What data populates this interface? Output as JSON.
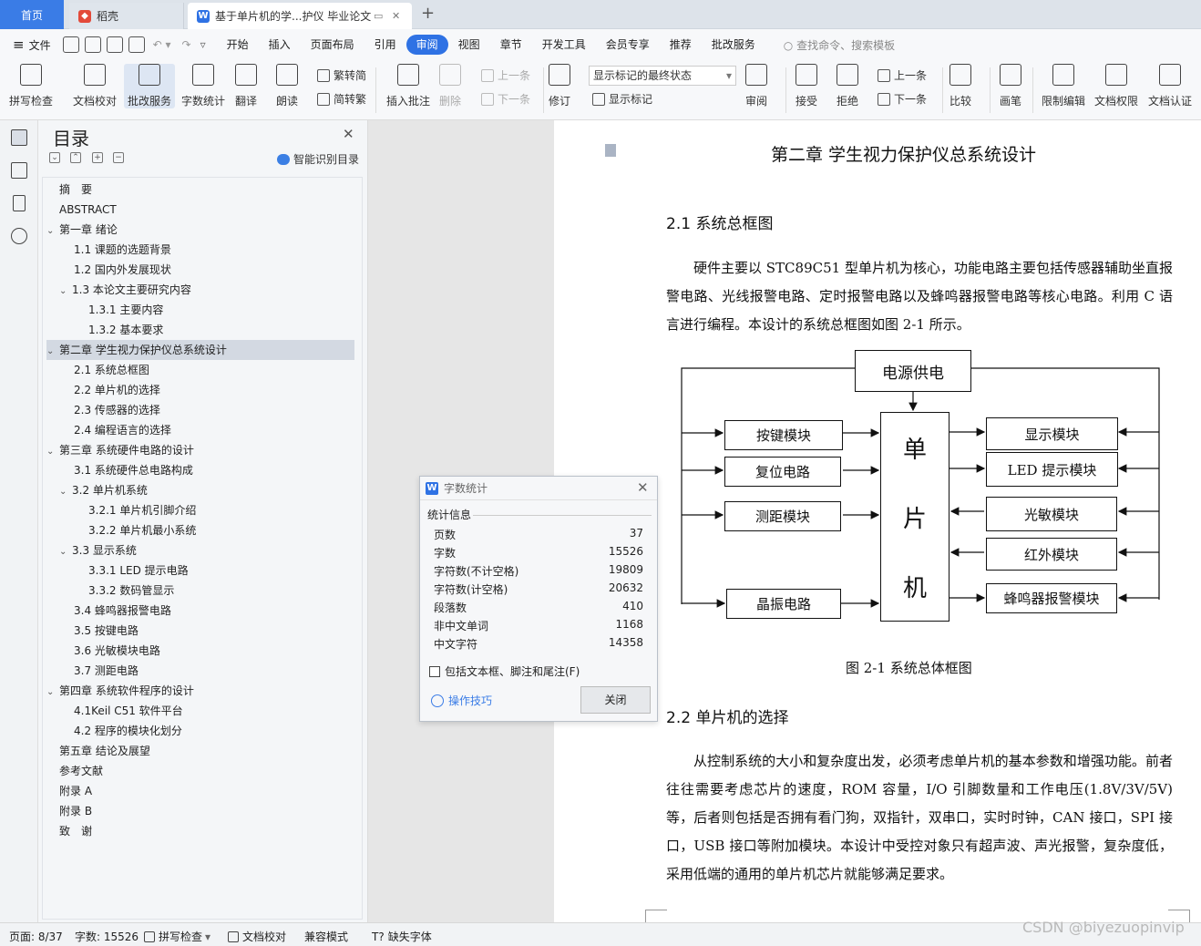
{
  "tabs": {
    "home": "首页",
    "docer": "稻壳",
    "doc": "基于单片机的学...护仪 毕业论文"
  },
  "menu": {
    "file": "文件",
    "items": [
      "开始",
      "插入",
      "页面布局",
      "引用",
      "审阅",
      "视图",
      "章节",
      "开发工具",
      "会员专享",
      "推荐",
      "批改服务"
    ],
    "active": "审阅",
    "search": "查找命令、搜索模板"
  },
  "ribbon": {
    "spell": "拼写检查",
    "doccheck": "文档校对",
    "correct": "批改服务",
    "wordcount": "字数统计",
    "translate": "翻译",
    "read": "朗读",
    "trad": "繁转简",
    "simp": "简转繁",
    "insert_comment": "插入批注",
    "delete": "删除",
    "prev": "上一条",
    "next": "下一条",
    "revise": "修订",
    "markup_state": "显示标记的最终状态",
    "show_markup": "显示标记",
    "review": "审阅",
    "accept": "接受",
    "reject": "拒绝",
    "prev2": "上一条",
    "next2": "下一条",
    "compare": "比较",
    "pen": "画笔",
    "restrict": "限制编辑",
    "perm": "文档权限",
    "cert": "文档认证"
  },
  "toc": {
    "title": "目录",
    "smart": "智能识别目录",
    "items": [
      {
        "text": "摘　要",
        "level": 0,
        "arrow": ""
      },
      {
        "text": "ABSTRACT",
        "level": 0,
        "arrow": ""
      },
      {
        "text": "第一章  绪论",
        "level": 0,
        "arrow": "v"
      },
      {
        "text": "1.1 课题的选题背景",
        "level": 1,
        "arrow": ""
      },
      {
        "text": "1.2 国内外发展现状",
        "level": 1,
        "arrow": ""
      },
      {
        "text": "1.3 本论文主要研究内容",
        "level": 1,
        "arrow": "v"
      },
      {
        "text": "1.3.1 主要内容",
        "level": 2,
        "arrow": ""
      },
      {
        "text": "1.3.2 基本要求",
        "level": 2,
        "arrow": ""
      },
      {
        "text": "第二章    学生视力保护仪总系统设计",
        "level": 0,
        "arrow": "v",
        "hl": true
      },
      {
        "text": "2.1 系统总框图",
        "level": 1,
        "arrow": ""
      },
      {
        "text": "2.2 单片机的选择",
        "level": 1,
        "arrow": ""
      },
      {
        "text": "2.3 传感器的选择",
        "level": 1,
        "arrow": ""
      },
      {
        "text": "2.4 编程语言的选择",
        "level": 1,
        "arrow": ""
      },
      {
        "text": "第三章  系统硬件电路的设计",
        "level": 0,
        "arrow": "v"
      },
      {
        "text": "3.1 系统硬件总电路构成",
        "level": 1,
        "arrow": ""
      },
      {
        "text": "3.2 单片机系统",
        "level": 1,
        "arrow": "v"
      },
      {
        "text": "3.2.1 单片机引脚介绍",
        "level": 2,
        "arrow": ""
      },
      {
        "text": "3.2.2 单片机最小系统",
        "level": 2,
        "arrow": ""
      },
      {
        "text": "3.3 显示系统",
        "level": 1,
        "arrow": "v"
      },
      {
        "text": "3.3.1 LED 提示电路",
        "level": 2,
        "arrow": ""
      },
      {
        "text": "3.3.2 数码管显示",
        "level": 2,
        "arrow": ""
      },
      {
        "text": "3.4 蜂鸣器报警电路",
        "level": 1,
        "arrow": ""
      },
      {
        "text": "3.5 按键电路",
        "level": 1,
        "arrow": ""
      },
      {
        "text": "3.6 光敏模块电路",
        "level": 1,
        "arrow": ""
      },
      {
        "text": "3.7 测距电路",
        "level": 1,
        "arrow": ""
      },
      {
        "text": "第四章  系统软件程序的设计",
        "level": 0,
        "arrow": "v"
      },
      {
        "text": "4.1Keil C51 软件平台",
        "level": 1,
        "arrow": ""
      },
      {
        "text": "4.2 程序的模块化划分",
        "level": 1,
        "arrow": ""
      },
      {
        "text": "第五章    结论及展望",
        "level": 0,
        "arrow": ""
      },
      {
        "text": "参考文献",
        "level": 0,
        "arrow": ""
      },
      {
        "text": "附录  A",
        "level": 0,
        "arrow": ""
      },
      {
        "text": "附录  B",
        "level": 0,
        "arrow": ""
      },
      {
        "text": "致　谢",
        "level": 0,
        "arrow": ""
      }
    ]
  },
  "doc": {
    "chapter_title": "第二章    学生视力保护仪总系统设计",
    "sec21": "2.1 系统总框图",
    "para1": "硬件主要以 STC89C51 型单片机为核心，功能电路主要包括传感器辅助坐直报警电路、光线报警电路、定时报警电路以及蜂鸣器报警电路等核心电路。利用 C 语言进行编程。本设计的系统总框图如图 2-1 所示。",
    "diagram": {
      "power": "电源供电",
      "mcu": [
        "单",
        "片",
        "机"
      ],
      "left": [
        "按键模块",
        "复位电路",
        "测距模块",
        "晶振电路"
      ],
      "right": [
        "显示模块",
        "LED 提示模块",
        "光敏模块",
        "红外模块",
        "蜂鸣器报警模块"
      ]
    },
    "caption": "图 2-1    系统总体框图",
    "sec22": "2.2 单片机的选择",
    "para2": "从控制系统的大小和复杂度出发，必须考虑单片机的基本参数和增强功能。前者往往需要考虑芯片的速度，ROM 容量，I/O 引脚数量和工作电压(1.8V/3V/5V)等，后者则包括是否拥有看门狗，双指针，双串口，实时时钟，CAN 接口，SPI 接口，USB 接口等附加模块。本设计中受控对象只有超声波、声光报警，复杂度低，采用低端的通用的单片机芯片就能够满足要求。"
  },
  "dialog": {
    "title": "字数统计",
    "section": "统计信息",
    "rows": [
      {
        "label": "页数",
        "value": "37"
      },
      {
        "label": "字数",
        "value": "15526"
      },
      {
        "label": "字符数(不计空格)",
        "value": "19809"
      },
      {
        "label": "字符数(计空格)",
        "value": "20632"
      },
      {
        "label": "段落数",
        "value": "410"
      },
      {
        "label": "非中文单词",
        "value": "1168"
      },
      {
        "label": "中文字符",
        "value": "14358"
      }
    ],
    "include": "包括文本框、脚注和尾注(F)",
    "tips": "操作技巧",
    "close": "关闭"
  },
  "status": {
    "page": "页面: 8/37",
    "words": "字数: 15526",
    "spell": "拼写检查",
    "doccheck": "文档校对",
    "compat": "兼容模式",
    "missing_font": "缺失字体",
    "watermark": "CSDN @biyezuopinvip"
  }
}
